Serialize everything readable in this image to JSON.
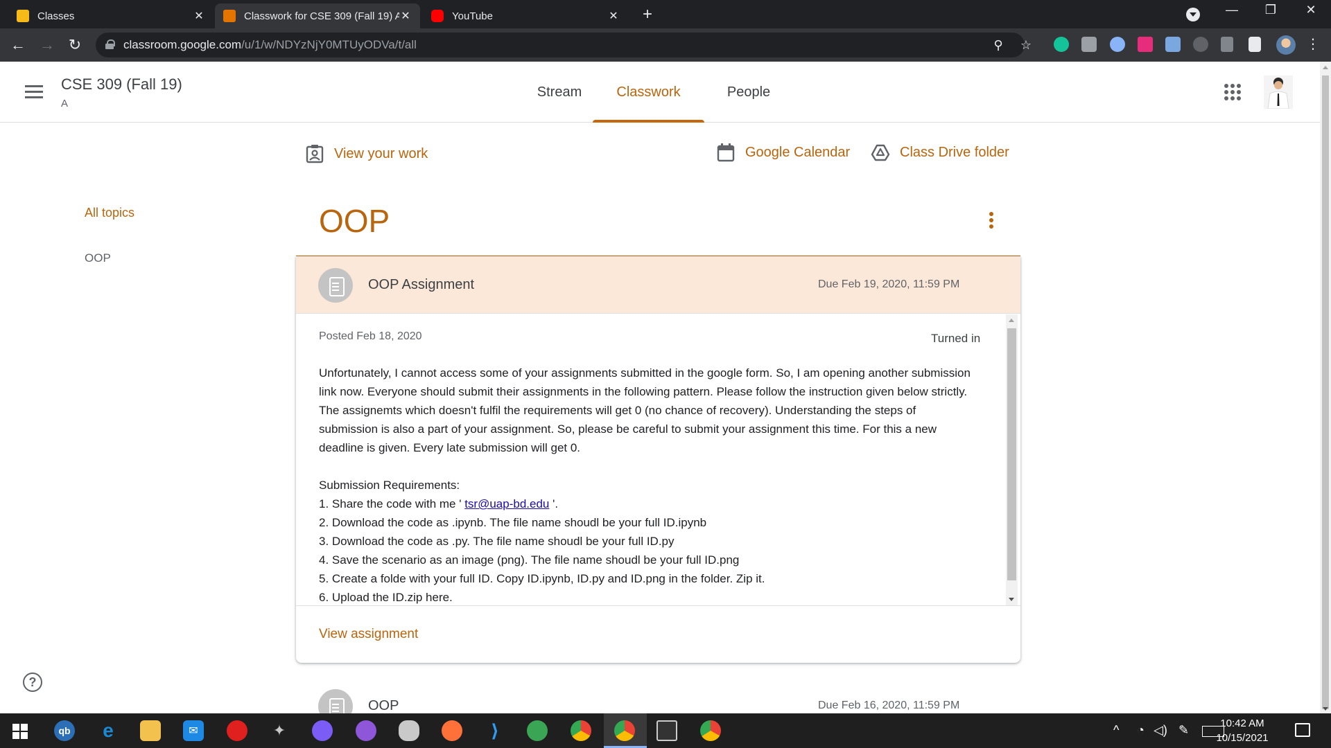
{
  "browser": {
    "tabs": [
      {
        "title": "Classes",
        "favicon_color": "#f6bb18",
        "active": false
      },
      {
        "title": "Classwork for CSE 309 (Fall 19) A",
        "favicon_color": "#e37400",
        "active": true
      },
      {
        "title": "YouTube",
        "favicon_color": "#ff0000",
        "active": false
      }
    ],
    "url_host": "classroom.google.com",
    "url_path": "/u/1/w/NDYzNjY0MTUyODVa/t/all"
  },
  "header": {
    "class_title": "CSE 309 (Fall 19)",
    "class_section": "A",
    "nav": [
      "Stream",
      "Classwork",
      "People"
    ],
    "active_nav": "Classwork"
  },
  "actions": {
    "view_work": "View your work",
    "calendar": "Google Calendar",
    "drive": "Class Drive folder"
  },
  "sidebar": {
    "all_topics": "All topics",
    "topics": [
      "OOP"
    ]
  },
  "topic": {
    "title": "OOP"
  },
  "assignment": {
    "title": "OOP Assignment",
    "due": "Due Feb 19, 2020, 11:59 PM",
    "posted": "Posted Feb 18, 2020",
    "status": "Turned in",
    "paragraph": "Unfortunately, I cannot access some of your assignments submitted in the google form. So, I am opening another submission link now. Everyone should submit their assignments in the following pattern. Please follow the instruction given below strictly. The assignemts which doesn't fulfil the requirements will get 0 (no chance of recovery). Understanding the steps of submission is also a part of your assignment. So, please be careful to submit your assignment this time. For this a new deadline is given. Every late submission will get 0.",
    "req_heading": "Submission Requirements:",
    "req1_prefix": "1. Share the code with me ' ",
    "req1_email": "tsr@uap-bd.edu",
    "req1_suffix": " '.",
    "req2": "2. Download the code as .ipynb. The file name shoudl be your full ID.ipynb",
    "req3": "3. Download the code as .py. The file name shoudl be your full ID.py",
    "req4": "4. Save the scenario as an image (png). The file name shoudl be your full ID.png",
    "req5": "5. Create a folde with your full ID. Copy ID.ipynb, ID.py and ID.png in the folder. Zip it.",
    "req6": "6. Upload the ID.zip here.",
    "view_link": "View assignment"
  },
  "next_assignment": {
    "title": "OOP",
    "due": "Due Feb 16, 2020, 11:59 PM"
  },
  "help": "?",
  "taskbar": {
    "time": "10:42 AM",
    "date": "10/15/2021",
    "apps": [
      "qb",
      "edge",
      "file-explorer",
      "mail",
      "opera",
      "satellite",
      "messenger",
      "github",
      "paint",
      "firefox",
      "vscode",
      "earth",
      "chrome",
      "chrome-active",
      "terminal",
      "chrome-canary"
    ]
  },
  "colors": {
    "accent": "#b9650d",
    "header_bg": "#fce8d9",
    "chrome_dark": "#202124"
  }
}
